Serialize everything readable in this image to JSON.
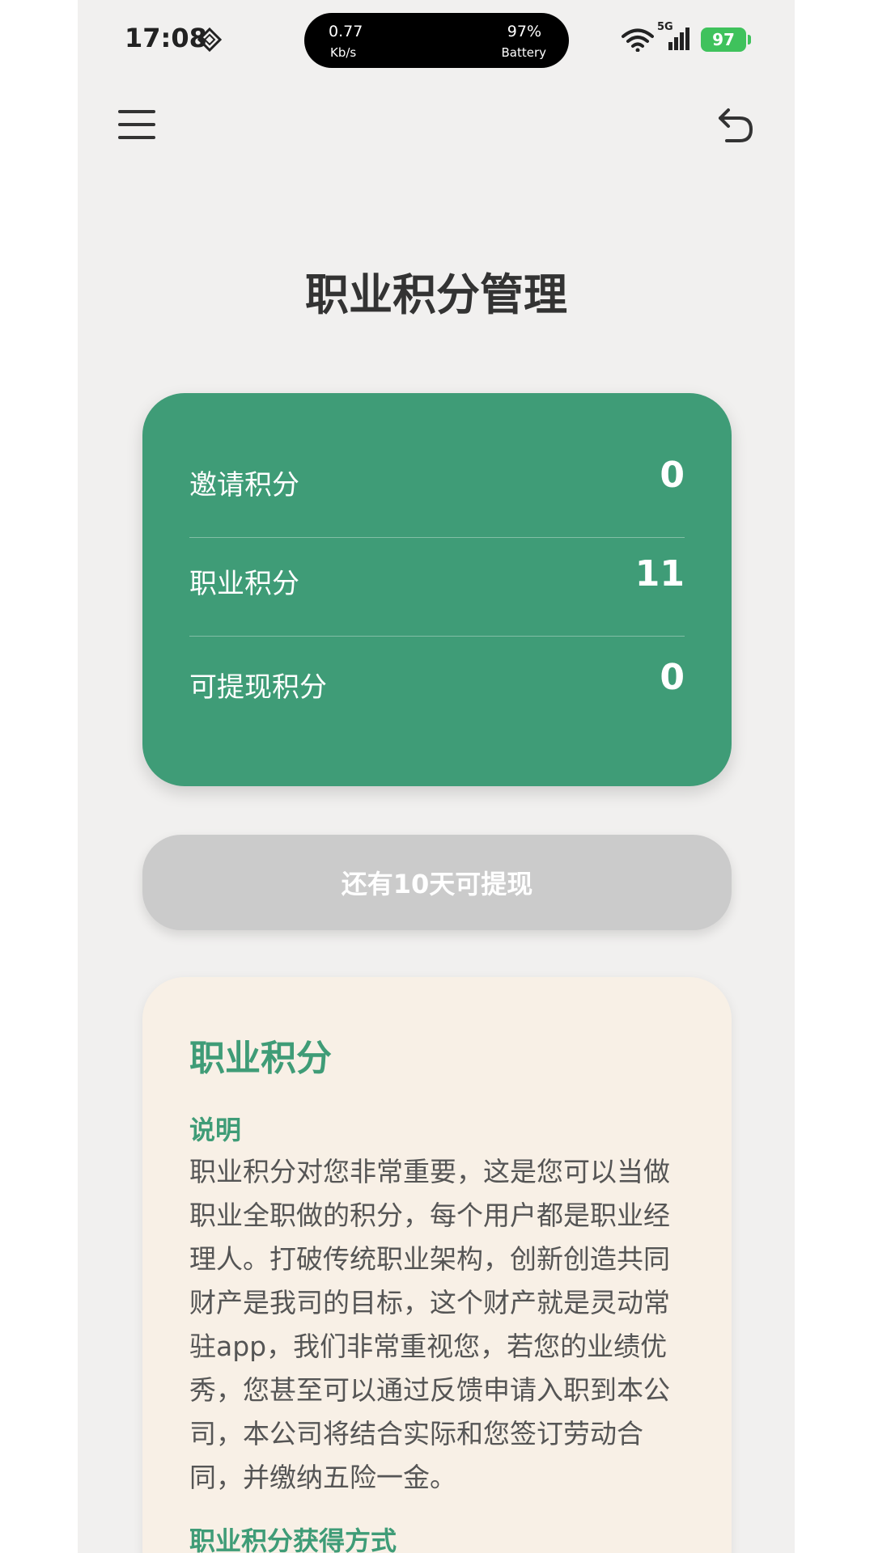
{
  "status_bar": {
    "time": "17:08",
    "net_speed": "0.77",
    "net_unit": "Kb/s",
    "battery_pct_pill": "97%",
    "battery_label": "Battery",
    "signal": "5G",
    "battery_level": "97"
  },
  "header": {
    "title": "职业积分管理"
  },
  "points": {
    "rows": [
      {
        "label": "邀请积分",
        "value": "0"
      },
      {
        "label": "职业积分",
        "value": "11"
      },
      {
        "label": "可提现积分",
        "value": "0"
      }
    ]
  },
  "withdraw": {
    "label": "还有10天可提现"
  },
  "info": {
    "title": "职业积分",
    "subtitle": "说明",
    "body": "职业积分对您非常重要，这是您可以当做职业全职做的积分，每个用户都是职业经理人。打破传统职业架构，创新创造共同财产是我司的目标，这个财产就是灵动常驻app，我们非常重视您，若您的业绩优秀，您甚至可以通过反馈申请入职到本公司，本公司将结合实际和您签订劳动合同，并缴纳五险一金。",
    "subtitle2": "职业积分获得方式"
  },
  "colors": {
    "accent": "#3f9c77",
    "card_bg": "#f8f0e6",
    "disabled_btn": "#cbcbcb"
  }
}
